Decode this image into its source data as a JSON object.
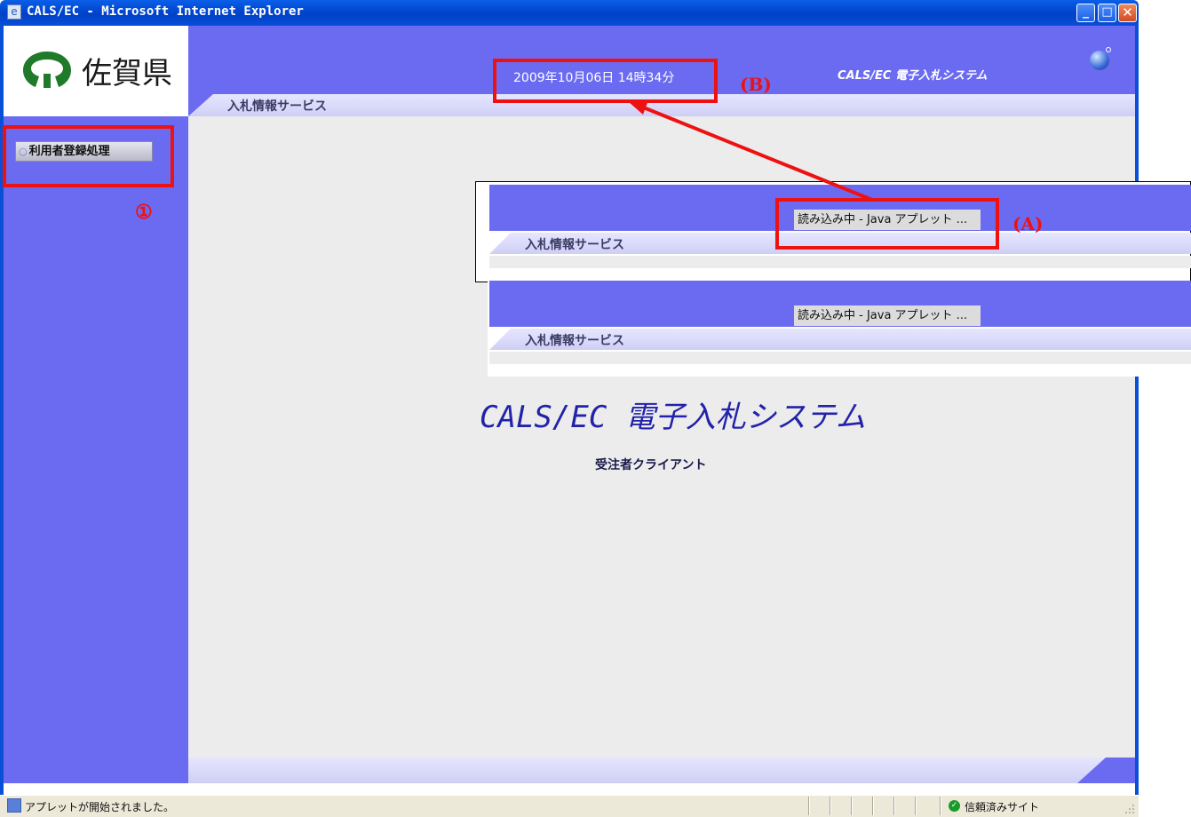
{
  "window": {
    "title": "CALS/EC - Microsoft Internet Explorer",
    "minimize_glyph": "_",
    "maximize_glyph": "□",
    "close_glyph": "✕"
  },
  "logo": {
    "text": "佐賀県"
  },
  "sidebar": {
    "menu_button_label": "利用者登録処理",
    "menu_bullet": "○"
  },
  "header": {
    "datetime": "2009年10月06日 14時34分",
    "system_name": "CALS/EC 電子入札システム",
    "tab_label": "入札情報サービス"
  },
  "main": {
    "title": "CALS/EC 電子入札システム",
    "subtitle": "受注者クライアント"
  },
  "inset_panels": [
    {
      "loading_text": "読み込み中 - Java アプレット ...",
      "tab_label": "入札情報サービス"
    },
    {
      "loading_text": "読み込み中 - Java アプレット ...",
      "tab_label": "入札情報サービス"
    }
  ],
  "annotations": {
    "b": "(B)",
    "a": "(A)",
    "one": "①"
  },
  "statusbar": {
    "status_text": "アプレットが開始されました。",
    "zone_text": "信頼済みサイト",
    "zone_icon_glyph": "✓"
  },
  "colors": {
    "accent_purple": "#6b6bf2",
    "annotation_red": "#ee1111",
    "titlebar_blue": "#0a4fd8"
  }
}
